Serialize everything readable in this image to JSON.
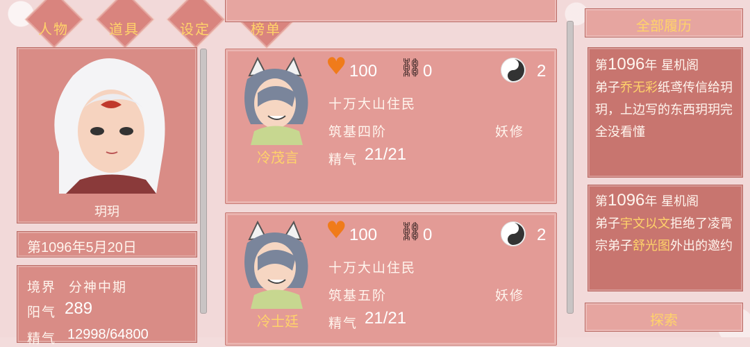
{
  "tabs": [
    {
      "label": "人物"
    },
    {
      "label": "道具"
    },
    {
      "label": "设定"
    },
    {
      "label": "榜单"
    }
  ],
  "character": {
    "name": "玥玥",
    "date": "第1096年5月20日",
    "realm_label": "境界",
    "realm_value": "分神中期",
    "yang_label": "阳气",
    "yang_value": "289",
    "jing_label": "精气",
    "jing_value": "12998/64800"
  },
  "cards": [
    {
      "name": "冷茂言",
      "health": "100",
      "bonds": "0",
      "yinyang": "2",
      "line1": "十万大山住民",
      "line2": "筑基四阶",
      "cultivation": "妖修",
      "essence_label": "精气",
      "essence_value": "21/21"
    },
    {
      "name": "冷士廷",
      "health": "100",
      "bonds": "0",
      "yinyang": "2",
      "line1": "十万大山住民",
      "line2": "筑基五阶",
      "cultivation": "妖修",
      "essence_label": "精气",
      "essence_value": "21/21"
    }
  ],
  "history": {
    "header": "全部履历",
    "entry1": {
      "year_prefix": "第",
      "year": "1096",
      "year_suffix": "年 星机阁",
      "text_a": "弟子",
      "highlight": "乔无彩",
      "text_b": "纸鸢传信给玥玥，上边写的东西玥玥完全没看懂"
    },
    "entry2": {
      "year_prefix": "第",
      "year": "1096",
      "year_suffix": "年 星机阁",
      "text_a": "弟子",
      "highlight1": "宇文以文",
      "text_b": "拒绝了凌霄宗弟子",
      "highlight2": "舒光",
      "highlight3": "图",
      "text_c": "外出的邀约"
    },
    "explore_label": "探索"
  },
  "colors": {
    "accent": "#ffd36a",
    "panel": "#d98c86",
    "heart": "#f07b1a"
  }
}
